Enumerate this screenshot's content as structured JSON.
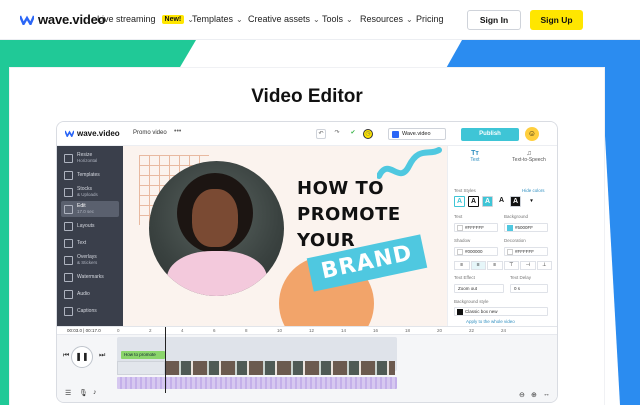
{
  "nav": {
    "logo": "wave.video",
    "items": [
      {
        "label": "Live streaming",
        "badge": "New!"
      },
      {
        "label": "Templates"
      },
      {
        "label": "Creative assets"
      },
      {
        "label": "Tools"
      },
      {
        "label": "Resources"
      },
      {
        "label": "Pricing"
      }
    ],
    "signin": "Sign In",
    "signup": "Sign Up"
  },
  "hero": {
    "title": "Video Editor"
  },
  "editor": {
    "logo": "wave.video",
    "project": "Promo video",
    "more": "•••",
    "brand_select": "Wave.video",
    "publish": "Publish",
    "sidebar": [
      {
        "label": "Resize",
        "sub": "Horizontal"
      },
      {
        "label": "Templates",
        "sub": ""
      },
      {
        "label": "Stocks",
        "sub": "& Uploads"
      },
      {
        "label": "Edit",
        "sub": "17.0 sec"
      },
      {
        "label": "Layouts",
        "sub": ""
      },
      {
        "label": "Text",
        "sub": ""
      },
      {
        "label": "Overlays",
        "sub": "& Stickers"
      },
      {
        "label": "Watermarks",
        "sub": ""
      },
      {
        "label": "Audio",
        "sub": ""
      },
      {
        "label": "Captions",
        "sub": ""
      }
    ],
    "canvas": {
      "line1": "HOW TO",
      "line2": "PROMOTE",
      "line3": "YOUR",
      "brand": "BRAND"
    },
    "panel": {
      "tab_text": "Text",
      "tab_tts": "Text-to-Speech",
      "text_styles": "Text Styles",
      "hide_colors": "Hide colors",
      "text_label": "Text",
      "background_label": "Background",
      "text_color": "#FFFFFF",
      "bg_color": "#5000FF",
      "shadow_label": "Shadow",
      "decoration_label": "Decoration",
      "shadow_color": "#000000",
      "decoration_color": "#FFFFFF",
      "text_effect_label": "Text Effect",
      "text_delay_label": "Text Delay",
      "text_effect": "Zoom out",
      "text_delay": "0 s",
      "bg_style_label": "Background style",
      "bg_style": "Classic box new",
      "apply_all": "Apply to the whole video"
    },
    "timeline": {
      "time": "00:03.0 | 00:17.0",
      "ticks": [
        "0",
        "2",
        "4",
        "6",
        "8",
        "10",
        "12",
        "14",
        "16",
        "18",
        "20",
        "22",
        "24"
      ],
      "text_clip": "How to promote"
    }
  },
  "colors": {
    "accent_yellow": "#ffe600",
    "accent_cyan": "#3ec5d6",
    "nav_blue": "#2b66f6"
  }
}
